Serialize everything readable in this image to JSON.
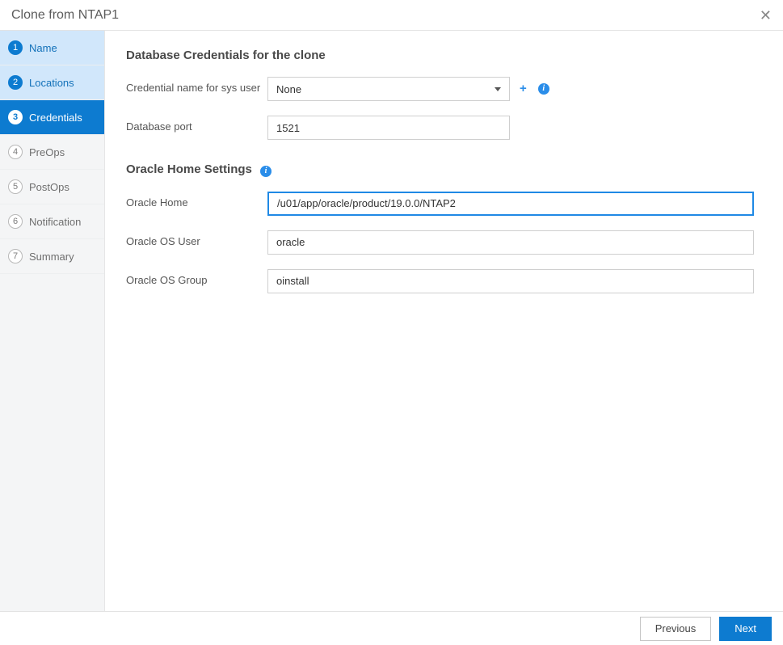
{
  "header": {
    "title": "Clone from NTAP1"
  },
  "steps": [
    {
      "num": "1",
      "label": "Name"
    },
    {
      "num": "2",
      "label": "Locations"
    },
    {
      "num": "3",
      "label": "Credentials"
    },
    {
      "num": "4",
      "label": "PreOps"
    },
    {
      "num": "5",
      "label": "PostOps"
    },
    {
      "num": "6",
      "label": "Notification"
    },
    {
      "num": "7",
      "label": "Summary"
    }
  ],
  "dbcred": {
    "heading": "Database Credentials for the clone",
    "credLabel": "Credential name for sys user",
    "credValue": "None",
    "portLabel": "Database port",
    "portValue": "1521"
  },
  "oracle": {
    "heading": "Oracle Home Settings",
    "homeLabel": "Oracle Home",
    "homeValue": "/u01/app/oracle/product/19.0.0/NTAP2",
    "osUserLabel": "Oracle OS User",
    "osUserValue": "oracle",
    "osGroupLabel": "Oracle OS Group",
    "osGroupValue": "oinstall"
  },
  "footer": {
    "prev": "Previous",
    "next": "Next"
  }
}
